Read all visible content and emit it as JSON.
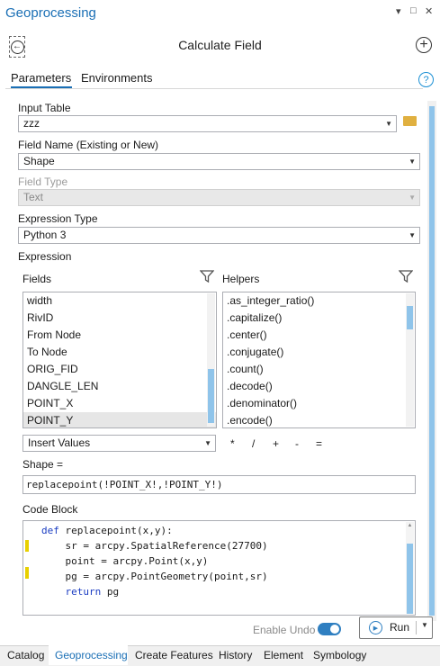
{
  "panel": {
    "title": "Geoprocessing",
    "controls": {
      "menu": "▾",
      "maximize": "□",
      "close": "✕"
    }
  },
  "tool": {
    "title": "Calculate Field"
  },
  "tabs": {
    "parameters": "Parameters",
    "environments": "Environments",
    "help": "?"
  },
  "input_table": {
    "label": "Input Table",
    "value": "zzz"
  },
  "field_name": {
    "label": "Field Name (Existing or New)",
    "value": "Shape"
  },
  "field_type": {
    "label": "Field Type",
    "value": "Text"
  },
  "expression_type": {
    "label": "Expression Type",
    "value": "Python 3"
  },
  "expression": {
    "label": "Expression",
    "fields_label": "Fields",
    "helpers_label": "Helpers",
    "fields": [
      "width",
      "RivID",
      "From Node",
      "To Node",
      "ORIG_FID",
      "DANGLE_LEN",
      "POINT_X",
      "POINT_Y"
    ],
    "selected_field": "POINT_Y",
    "helpers": [
      ".as_integer_ratio()",
      ".capitalize()",
      ".center()",
      ".conjugate()",
      ".count()",
      ".decode()",
      ".denominator()",
      ".encode()"
    ],
    "insert_values": "Insert Values",
    "operators": [
      "*",
      "/",
      "+",
      "-",
      "="
    ],
    "target_label": "Shape =",
    "value": "replacepoint(!POINT_X!,!POINT_Y!)"
  },
  "code_block": {
    "label": "Code Block",
    "lines": [
      {
        "kw": "def",
        "text": " replacepoint(x,y):"
      },
      {
        "kw": "",
        "text": "    sr = arcpy.SpatialReference(27700)"
      },
      {
        "kw": "",
        "text": "    point = arcpy.Point(x,y)"
      },
      {
        "kw": "",
        "text": "    pg = arcpy.PointGeometry(point,sr)"
      },
      {
        "kw": "    return",
        "text": " pg"
      }
    ]
  },
  "footer": {
    "undo_label": "Enable Undo",
    "undo_enabled": true,
    "run_label": "Run"
  },
  "bottom_tabs": [
    "Catalog",
    "Geoprocessing",
    "Create Features",
    "History",
    "Element",
    "Symbology"
  ],
  "colors": {
    "accent": "#1a6fb5",
    "scroll_thumb": "#8fc4ea",
    "change_marker": "#e8d000"
  }
}
